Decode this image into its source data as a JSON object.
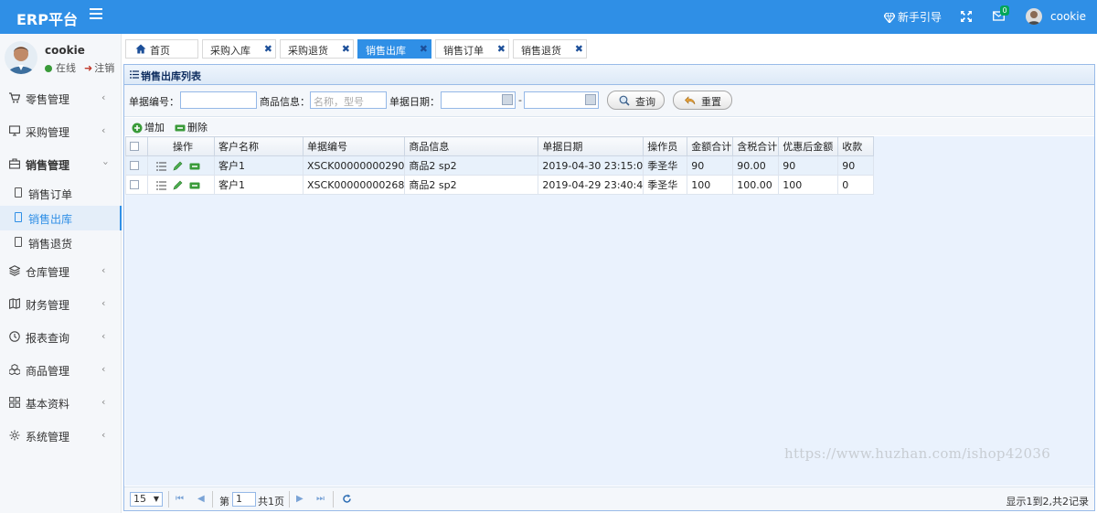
{
  "header": {
    "brand": "ERP平台",
    "guide_label": "新手引导",
    "mail_count": "0",
    "user_name": "cookie"
  },
  "sidebar": {
    "profile": {
      "name": "cookie",
      "status": "在线",
      "logout": "注销"
    },
    "items": [
      {
        "label": "零售管理",
        "icon": "cart-icon"
      },
      {
        "label": "采购管理",
        "icon": "monitor-icon"
      },
      {
        "label": "销售管理",
        "icon": "briefcase-icon"
      },
      {
        "label": "仓库管理",
        "icon": "layers-icon"
      },
      {
        "label": "财务管理",
        "icon": "map-icon"
      },
      {
        "label": "报表查询",
        "icon": "clock-icon"
      },
      {
        "label": "商品管理",
        "icon": "cubes-icon"
      },
      {
        "label": "基本资料",
        "icon": "grid-icon"
      },
      {
        "label": "系统管理",
        "icon": "gear-icon"
      }
    ],
    "sales_sub": [
      {
        "label": "销售订单"
      },
      {
        "label": "销售出库"
      },
      {
        "label": "销售退货"
      }
    ]
  },
  "tabs": [
    {
      "label": "首页"
    },
    {
      "label": "采购入库"
    },
    {
      "label": "采购退货"
    },
    {
      "label": "销售出库"
    },
    {
      "label": "销售订单"
    },
    {
      "label": "销售退货"
    }
  ],
  "panel": {
    "title": "销售出库列表",
    "search": {
      "number_label": "单据编号：",
      "number_value": "",
      "goods_label": "商品信息：",
      "goods_placeholder": "名称，型号",
      "date_label": "单据日期：",
      "date_sep": "-",
      "query_label": "查询",
      "reset_label": "重置"
    },
    "toolbar": {
      "add_label": "增加",
      "delete_label": "删除"
    },
    "columns": [
      "操作",
      "客户名称",
      "单据编号",
      "商品信息",
      "单据日期",
      "操作员",
      "金额合计",
      "含税合计",
      "优惠后金额",
      "收款"
    ],
    "rows": [
      {
        "customer": "客户1",
        "number": "XSCK00000000290",
        "goods": "商品2 sp2",
        "date": "2019-04-30 23:15:0",
        "operator": "季圣华",
        "amount": "90",
        "tax_total": "90.00",
        "discounted": "90",
        "received": "90"
      },
      {
        "customer": "客户1",
        "number": "XSCK00000000268",
        "goods": "商品2 sp2",
        "date": "2019-04-29 23:40:4",
        "operator": "季圣华",
        "amount": "100",
        "tax_total": "100.00",
        "discounted": "100",
        "received": "0"
      }
    ],
    "pager": {
      "page_size": "15",
      "page_prefix": "第",
      "page_number": "1",
      "page_suffix": "共1页",
      "info": "显示1到2,共2记录"
    }
  },
  "watermark": "https://www.huzhan.com/ishop42036",
  "colors": {
    "primary": "#2f8fe6",
    "panel_border": "#99bbe8"
  }
}
